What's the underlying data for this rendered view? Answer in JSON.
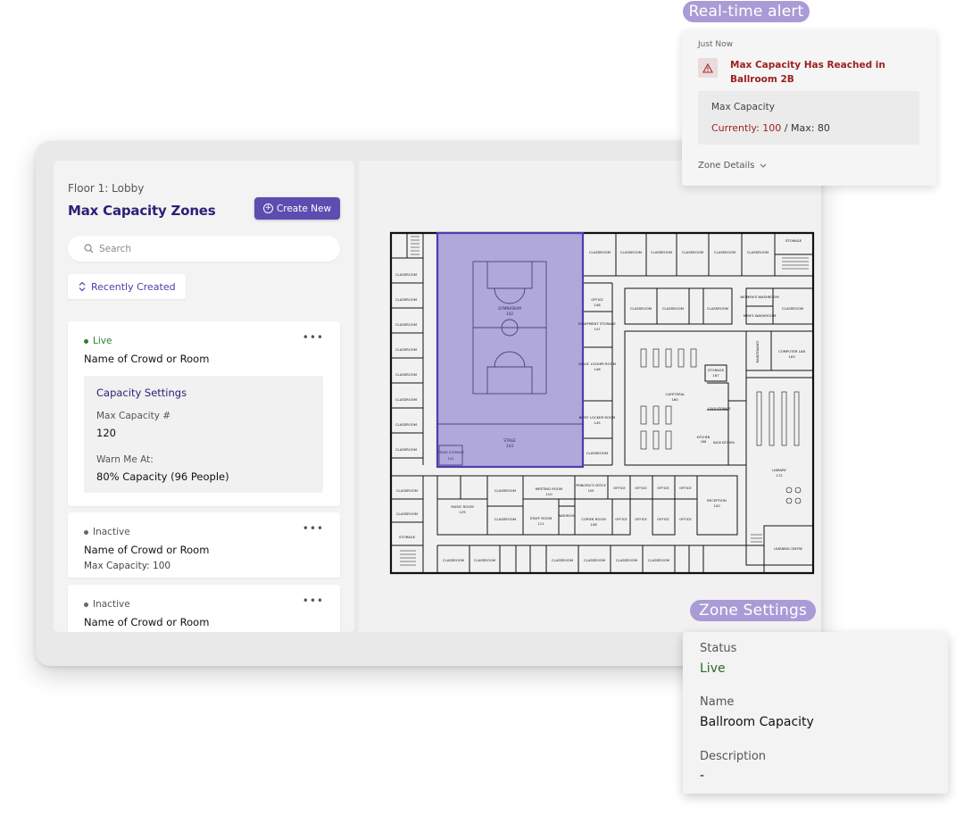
{
  "left_panel": {
    "floor_label": "Floor 1: Lobby",
    "title": "Max Capacity Zones",
    "create_label": "Create New",
    "search_placeholder": "Search",
    "sort_label": "Recently Created"
  },
  "zones": [
    {
      "status": "Live",
      "name": "Name of Crowd or Room",
      "capacity_title": "Capacity Settings",
      "max_capacity_label": "Max Capacity #",
      "max_capacity_value": "120",
      "warn_label": "Warn Me At:",
      "warn_value": "80% Capacity (96 People)"
    },
    {
      "status": "Inactive",
      "name": "Name of Crowd or Room",
      "max_capacity_text": "Max Capacity: 100"
    },
    {
      "status": "Inactive",
      "name": "Name of Crowd or Room"
    }
  ],
  "alert": {
    "tag": "Real-time alert",
    "time": "Just Now",
    "message": "Max Capacity Has Reached in Ballroom 2B",
    "box_title": "Max Capacity",
    "currently_label": "Currently: 100",
    "max_label": "/ Max: 80",
    "details_label": "Zone Details"
  },
  "zone_settings": {
    "tag": "Zone Settings",
    "status_label": "Status",
    "status_value": "Live",
    "name_label": "Name",
    "name_value": "Ballroom Capacity",
    "description_label": "Description",
    "description_value": "-"
  },
  "floorplan": {
    "highlight_color": "#a49ad6",
    "rooms": {
      "gymnasium": "GYMNASIUM",
      "gym_no": "142",
      "stage": "STAGE",
      "stage_no": "143",
      "stage_storage": "STAGE STORAGE",
      "stage_storage_no": "141",
      "cafeteria": "CAFETERIA",
      "cafeteria_no": "160",
      "library": "LIBRARY",
      "library_no": "172",
      "reception": "RECEPTION",
      "reception_no": "100",
      "computer_lab": "COMPUTER LAB",
      "computer_lab_no": "163",
      "learning_centre": "LEARNING CENTRE",
      "learning_centre_no": "171",
      "music_room": "MUSIC ROOM",
      "music_room_no": "129",
      "meeting_room": "MEETING ROOM",
      "meeting_room_no": "110",
      "staff_room": "STAFF ROOM",
      "staff_room_no": "111",
      "copier_room": "COPIER ROOM",
      "copier_room_no": "108",
      "principal": "PRINCIPLE'S OFFICE",
      "principal_no": "109",
      "kitchen": "KITCHEN",
      "kitchen_no": "168",
      "back_kitchen": "BACK KITCHEN",
      "back_kitchen_no": "169",
      "cold_storage": "COLD STORAGE",
      "cold_storage_no": "170",
      "storage": "STORAGE",
      "storage_no": "167",
      "equipment_storage": "EQUIPMENT STORAGE",
      "equipment_storage_no": "147",
      "girls_locker": "GIRLS' LOCKER ROOM",
      "girls_locker_no": "146",
      "boys_locker": "BOYS' LOCKER ROOM",
      "boys_locker_no": "145",
      "office": "OFFICE",
      "office_no": "148",
      "womens_washroom": "WOMEN'S WASHROOM",
      "mens_washroom": "MEN'S WASHROOM",
      "maintenance": "MAINTENANCE",
      "maintenance_no": "165",
      "washroom": "WASHROOM",
      "classroom": "CLASSROOM"
    }
  }
}
